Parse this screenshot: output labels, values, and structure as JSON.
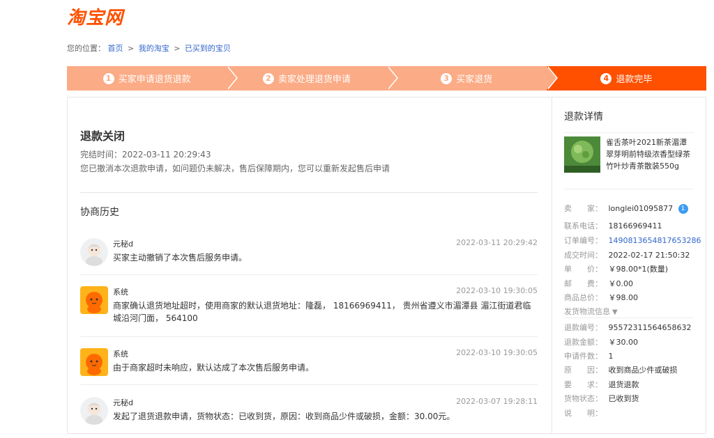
{
  "logo": {
    "text": "淘宝网"
  },
  "breadcrumb": {
    "prefix": "您的位置：",
    "items": [
      "首页",
      "我的淘宝",
      "已买到的宝贝"
    ],
    "sep": ">"
  },
  "steps": [
    {
      "num": "1",
      "label": "买家申请退货退款"
    },
    {
      "num": "2",
      "label": "卖家处理退货申请"
    },
    {
      "num": "3",
      "label": "买家退货"
    },
    {
      "num": "4",
      "label": "退款完毕"
    }
  ],
  "status": {
    "title": "退款关闭",
    "time": "完结时间：2022-03-11 20:29:43",
    "note": "您已撤消本次退款申请，如问题仍未解决，售后保障期内，您可以重新发起售后申请"
  },
  "history": {
    "title": "协商历史",
    "items": [
      {
        "name": "元秘d",
        "time": "2022-03-11 20:29:42",
        "msg": "买家主动撤销了本次售后服务申请。",
        "avatar": "user-avatar"
      },
      {
        "name": "系统",
        "time": "2022-03-10 19:30:05",
        "msg": "商家确认退货地址超时，使用商家的默认退货地址：隆磊， 18166969411， 贵州省遵义市湄潭县   湄江街道君临城沿河门面， 564100",
        "avatar": "system-avatar"
      },
      {
        "name": "系统",
        "time": "2022-03-10 19:30:05",
        "msg": "由于商家超时未响应，默认达成了本次售后服务申请。",
        "avatar": "system-avatar"
      },
      {
        "name": "元秘d",
        "time": "2022-03-07 19:28:11",
        "msg": "发起了退货退款申请，货物状态：已收到货，原因：收到商品少件或破损，金额：30.00元。",
        "avatar": "user-avatar"
      }
    ]
  },
  "side": {
    "title": "退款详情",
    "product": {
      "title": "雀舌茶叶2021新茶湄潭翠芽明前特级浓香型绿茶竹叶炒青茶散装550g",
      "img_label": "头采嫩芽 | 专注品质"
    },
    "details": [
      {
        "k": "卖　　家：",
        "v": "longlei01095877",
        "type": "ww"
      },
      {
        "k": "联系电话：",
        "v": "18166969411"
      },
      {
        "k": "订单编号：",
        "v": "1490813654817653286",
        "type": "link"
      },
      {
        "k": "成交时间：",
        "v": "2022-02-17 21:50:32"
      },
      {
        "k": "单　　价：",
        "v": "￥98.00*1(数量)"
      },
      {
        "k": "邮　　费：",
        "v": "￥0.00"
      },
      {
        "k": "商品总价：",
        "v": "￥98.00"
      },
      {
        "k": "发货物流信息",
        "v": "▼",
        "type": "toggle"
      }
    ],
    "refund": [
      {
        "k": "退款编号：",
        "v": "95572311564658632"
      },
      {
        "k": "退款金额：",
        "v": "￥30.00"
      },
      {
        "k": "申请件数：",
        "v": "1"
      },
      {
        "k": "原　　因：",
        "v": "收到商品少件或破损"
      },
      {
        "k": "要　　求：",
        "v": "退货退款"
      },
      {
        "k": "货物状态：",
        "v": "已收到货"
      },
      {
        "k": "说　　明：",
        "v": ""
      }
    ]
  },
  "colors": {
    "brand": "#ff5000",
    "step_done": "#fbab85",
    "link": "#3366cc"
  }
}
